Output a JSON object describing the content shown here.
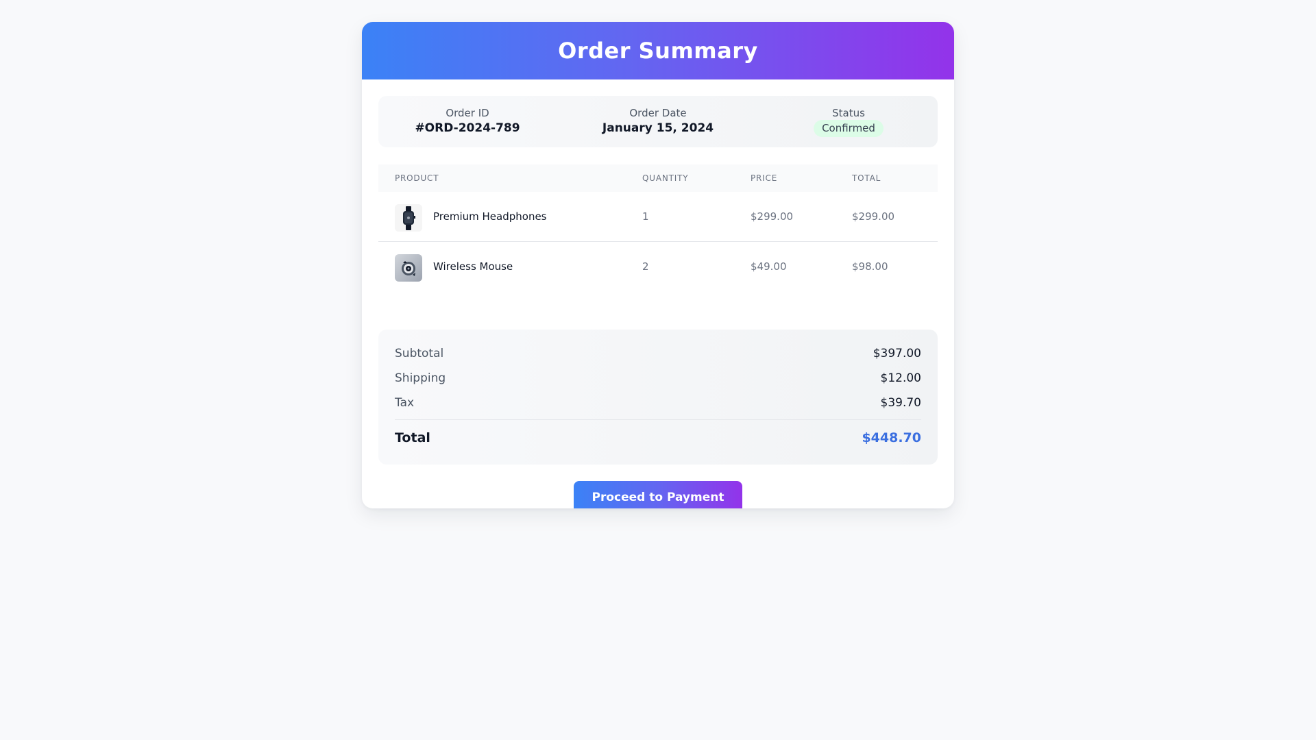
{
  "header": {
    "title": "Order Summary"
  },
  "order_info": {
    "id_label": "Order ID",
    "id_value": "#ORD-2024-789",
    "date_label": "Order Date",
    "date_value": "January 15, 2024",
    "status_label": "Status",
    "status_value": "Confirmed"
  },
  "table": {
    "headers": [
      "PRODUCT",
      "QUANTITY",
      "PRICE",
      "TOTAL"
    ],
    "rows": [
      {
        "product": "Premium Headphones",
        "quantity": "1",
        "price": "$299.00",
        "total": "$299.00",
        "icon": "smartwatch-icon"
      },
      {
        "product": "Wireless Mouse",
        "quantity": "2",
        "price": "$49.00",
        "total": "$98.00",
        "icon": "camera-lens-icon"
      }
    ]
  },
  "totals": {
    "subtotal_label": "Subtotal",
    "subtotal_value": "$397.00",
    "shipping_label": "Shipping",
    "shipping_value": "$12.00",
    "tax_label": "Tax",
    "tax_value": "$39.70",
    "total_label": "Total",
    "total_value": "$448.70"
  },
  "actions": {
    "pay_label": "Proceed to Payment"
  },
  "colors": {
    "gradient_start": "#3b82f6",
    "gradient_end": "#9333ea",
    "total_accent": "#3b6fe0",
    "status_bg": "#dcfce7"
  }
}
